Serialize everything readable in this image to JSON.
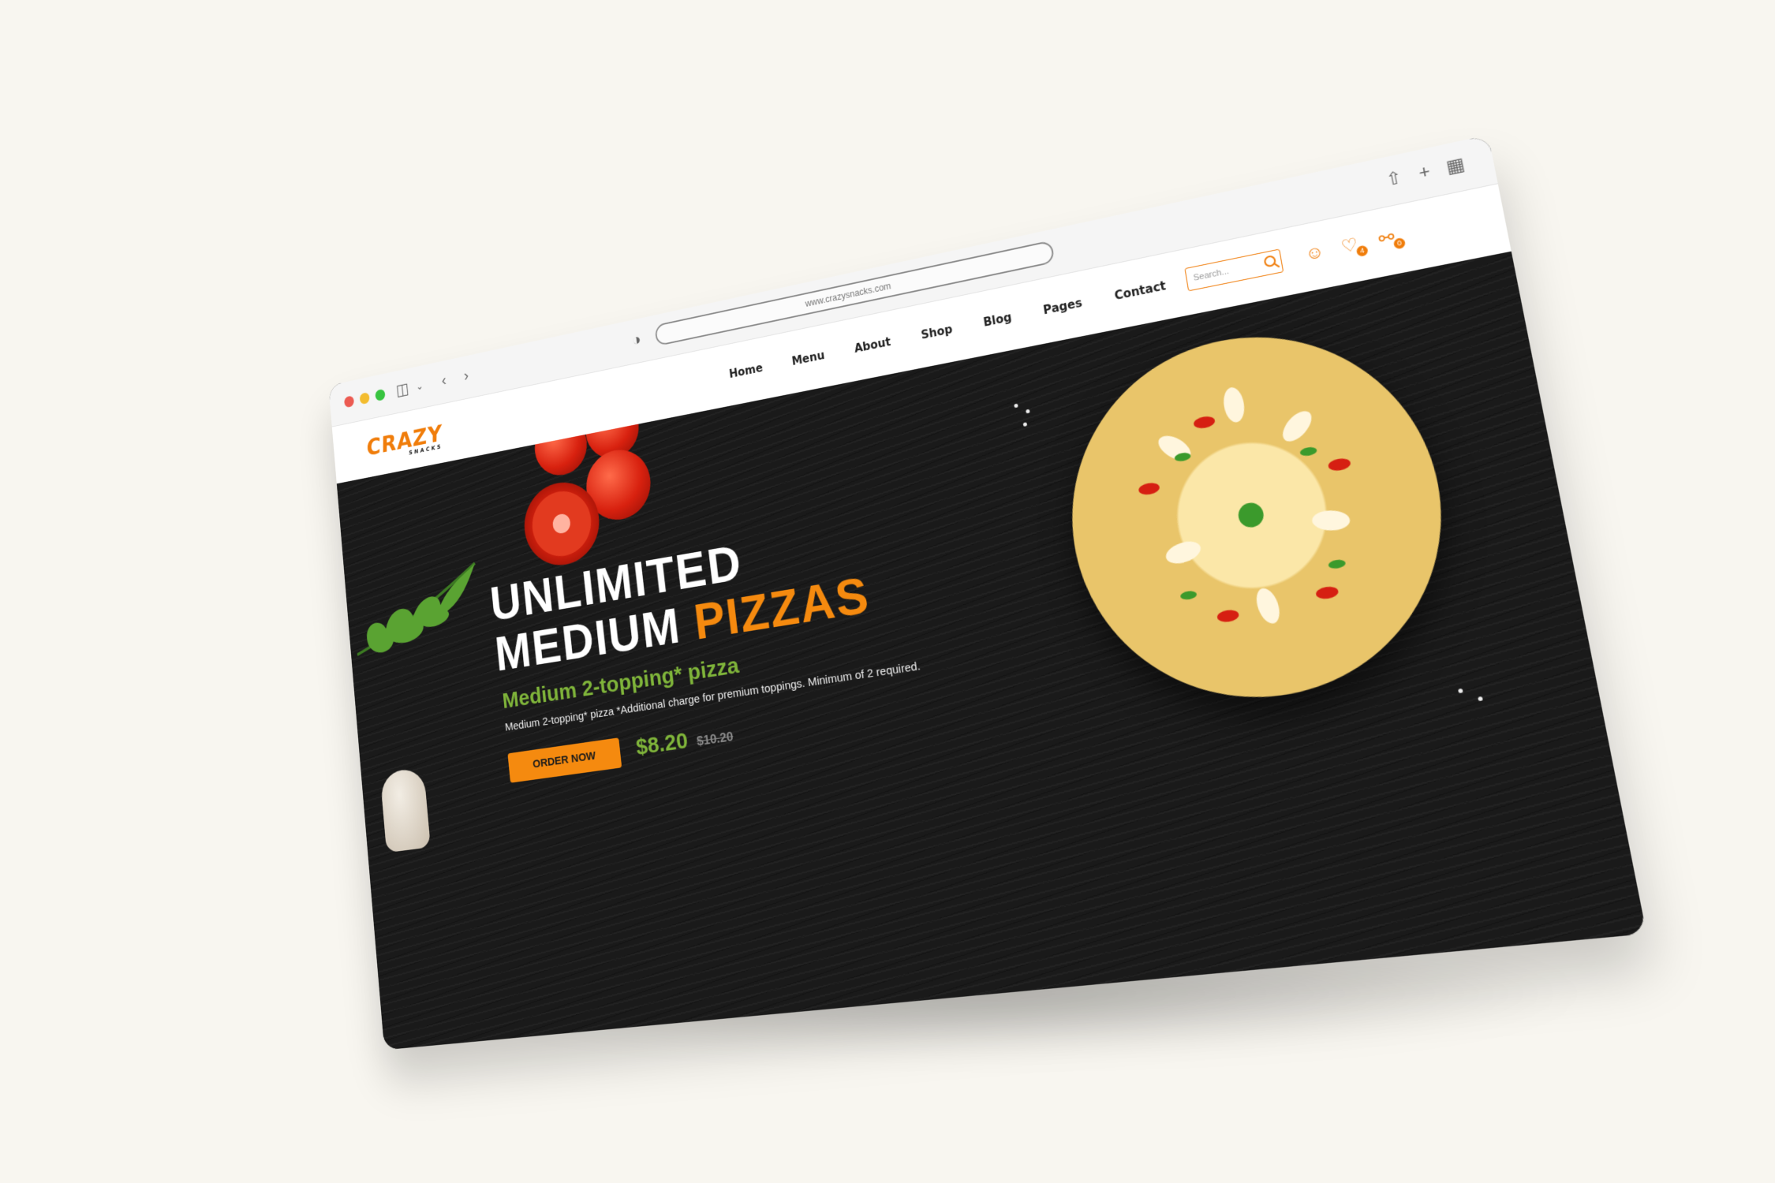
{
  "browser": {
    "url": "www.crazysnacks.com",
    "icons": {
      "sidebar": "sidebar-icon",
      "back": "chevron-left-icon",
      "forward": "chevron-right-icon",
      "shield": "shield-icon",
      "share": "share-icon",
      "new_tab": "plus-icon",
      "tabs": "tab-grid-icon"
    }
  },
  "site": {
    "logo_text": "CRAZY",
    "logo_subtext": "SNACKS",
    "nav": [
      {
        "label": "Home"
      },
      {
        "label": "Menu"
      },
      {
        "label": "About"
      },
      {
        "label": "Shop"
      },
      {
        "label": "Blog"
      },
      {
        "label": "Pages"
      },
      {
        "label": "Contact"
      }
    ],
    "search_placeholder": "Search...",
    "wishlist_count": "4",
    "cart_count": "0"
  },
  "hero": {
    "title_line1": "UNLIMITED",
    "title_line2": "MEDIUM",
    "title_accent": "PIZZAS",
    "subtitle": "Medium 2-topping* pizza",
    "description": "Medium 2-topping* pizza *Additional charge for premium toppings. Minimum of 2 required.",
    "cta_label": "ORDER NOW",
    "price": "$8.20",
    "old_price": "$10.20"
  },
  "colors": {
    "accent": "#f58a0f",
    "green": "#7fb43a",
    "hero_bg": "#1a1a1a"
  }
}
